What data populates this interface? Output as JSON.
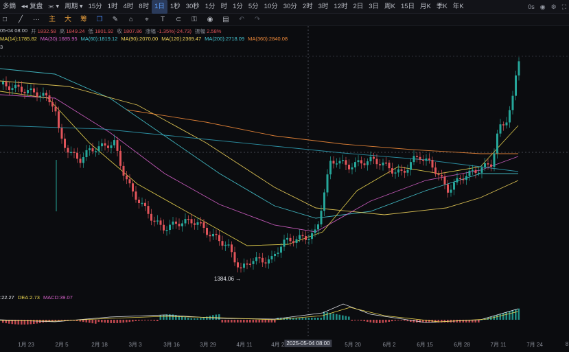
{
  "toolbar": {
    "symbol": "多鏑",
    "compare": "复盘",
    "chart_type_icon": "chart-icon",
    "period_label": "周期",
    "intervals": [
      "15分",
      "1时",
      "4时",
      "8时",
      "1日",
      "1秒",
      "30秒",
      "1分",
      "时",
      "1分",
      "5分",
      "10分",
      "30分",
      "2时",
      "3时",
      "12时",
      "2日",
      "3日",
      "周K",
      "15日",
      "月K",
      "季K",
      "年K"
    ],
    "active_interval": "1日",
    "right": [
      "0s",
      "camera-icon",
      "settings-icon",
      "fullscreen-icon"
    ]
  },
  "drawing_tools": [
    "□",
    "╱",
    "···",
    "主",
    "大",
    "筹"
  ],
  "info_line": {
    "date": "05-04 08:00",
    "open_label": "开",
    "open": "1832.58",
    "high_label": "高",
    "high": "1849.24",
    "low_label": "低",
    "low": "1801.92",
    "close_label": "收",
    "close": "1807.86",
    "change_label": "涨幅",
    "change": "-1.35%(-24.73)",
    "amp_label": "振幅",
    "amp": "2.58%"
  },
  "ma_line": [
    {
      "label": "MA(14):1785.82",
      "color": "#e9d44f"
    },
    {
      "label": "MA(30):1685.95",
      "color": "#d561c9"
    },
    {
      "label": "MA(60):1819.12",
      "color": "#46c6d2"
    },
    {
      "label": "MA(90):2070.00",
      "color": "#f0d35a"
    },
    {
      "label": "MA(120):2369.47",
      "color": "#f0d35a"
    },
    {
      "label": "MA(200):2718.09",
      "color": "#46c6d2"
    },
    {
      "label": "MA(360):2840.08",
      "color": "#f08a3a"
    }
  ],
  "info3": "3",
  "low_marker": "1384.06",
  "macd": {
    "dif_label": ":22.27",
    "dea_label": "DEA:2.73",
    "macd_label": "MACD:39.07",
    "dea_color": "#e9d44f",
    "macd_color": "#d561c9"
  },
  "xaxis": {
    "labels": [
      "1月 23",
      "2月 5",
      "2月 18",
      "3月 3",
      "3月 16",
      "3月 29",
      "4月 11",
      "4月 24",
      "5月 20",
      "6月 2",
      "6月 15",
      "6月 28",
      "7月 11",
      "7月 24",
      "8"
    ],
    "cursor": "2025-05-04 08:00"
  },
  "colors": {
    "up": "#26a69a",
    "down": "#e0545a",
    "bg": "#0b0c0f",
    "accent": "#4d8dff"
  }
}
